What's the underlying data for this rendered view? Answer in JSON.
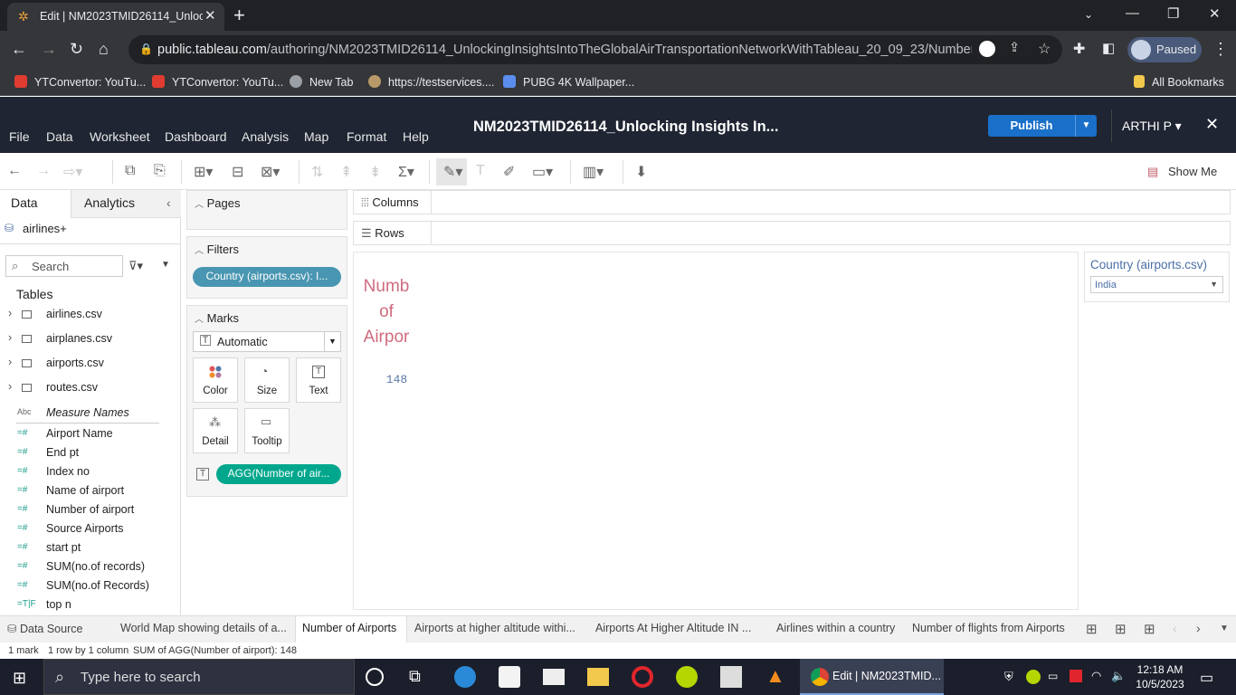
{
  "browser": {
    "tab_title": "Edit | NM2023TMID26114_Unlock",
    "url_host": "public.tableau.com",
    "url_path": "/authoring/NM2023TMID26114_UnlockingInsightsIntoTheGlobalAirTransportationNetworkWithTableau_20_09_23/Numberof...",
    "profile_status": "Paused",
    "bookmarks": [
      "YTConvertor: YouTu...",
      "YTConvertor: YouTu...",
      "New Tab",
      "https://testservices....",
      "PUBG 4K Wallpaper..."
    ],
    "all_bookmarks": "All Bookmarks"
  },
  "app": {
    "menus": [
      "File",
      "Data",
      "Worksheet",
      "Dashboard",
      "Analysis",
      "Map",
      "Format",
      "Help"
    ],
    "workbook_title": "NM2023TMID26114_Unlocking Insights In...",
    "publish_label": "Publish",
    "user": "ARTHI P ▾",
    "show_me": "Show Me"
  },
  "data_pane": {
    "tab_data": "Data",
    "tab_analytics": "Analytics",
    "datasource": "airlines+",
    "search_placeholder": "Search",
    "tables_header": "Tables",
    "tables": [
      "airlines.csv",
      "airplanes.csv",
      "airports.csv",
      "routes.csv"
    ],
    "measure_names": "Measure Names",
    "measure_names_icon": "Abc",
    "fields": [
      "Airport Name",
      "End pt",
      "Index no",
      "Name of airport",
      "Number of airport",
      "Source Airports",
      "start pt",
      "SUM(no.of records)",
      "SUM(no.of Records)",
      "top n"
    ]
  },
  "cards": {
    "pages": "Pages",
    "filters": "Filters",
    "filter_pill": "Country (airports.csv): I...",
    "marks": "Marks",
    "mark_type": "Automatic",
    "mark_buttons": [
      "Color",
      "Size",
      "Text",
      "Detail",
      "Tooltip"
    ],
    "text_pill": "AGG(Number of air..."
  },
  "shelves": {
    "columns": "Columns",
    "rows": "Rows"
  },
  "view": {
    "header_lines": [
      "Numb",
      "of",
      "Airpor"
    ],
    "value": "148"
  },
  "filter_card": {
    "title": "Country (airports.csv)",
    "selected": "India"
  },
  "sheets": {
    "data_source": "Data Source",
    "tabs": [
      "World Map showing details of a...",
      "Number of Airports",
      "Airports at higher altitude withi...",
      "Airports At Higher Altitude IN ...",
      "Airlines within a country",
      "Number of flights from Airports"
    ],
    "active_index": 1
  },
  "status": {
    "marks": "1 mark",
    "dims": "1 row by 1 column",
    "sum": "SUM of AGG(Number of airport): 148"
  },
  "taskbar": {
    "search_placeholder": "Type here to search",
    "chrome_label": "Edit | NM2023TMID...",
    "time": "12:18 AM",
    "date": "10/5/2023"
  },
  "colors": {
    "tableau_header": "#1f2532",
    "publish": "#1a6fc9",
    "pill_filter": "#4996b2",
    "pill_measure": "#00a78d",
    "header_text": "#d06b7e",
    "value_text": "#5a79a7"
  }
}
